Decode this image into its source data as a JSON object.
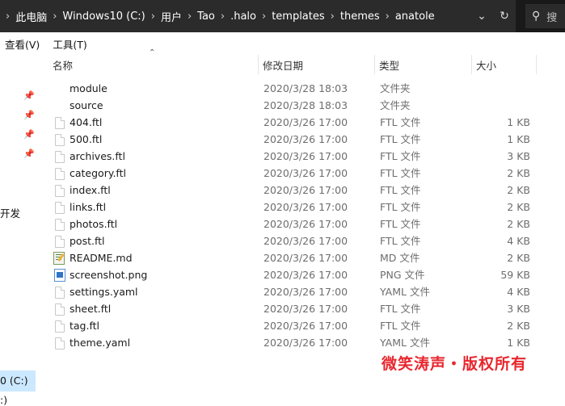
{
  "breadcrumb": [
    "此电脑",
    "Windows10 (C:)",
    "用户",
    "Tao",
    ".halo",
    "templates",
    "themes",
    "anatole"
  ],
  "search": {
    "placeholder": "搜"
  },
  "menu": [
    "查看(V)",
    "工具(T)"
  ],
  "sidebar": {
    "labels": [
      "开发",
      "0 (C:)",
      ":)"
    ]
  },
  "columns": {
    "name": "名称",
    "date": "修改日期",
    "type": "类型",
    "size": "大小"
  },
  "files": [
    {
      "name": "module",
      "date": "2020/3/28 18:03",
      "type": "文件夹",
      "size": "",
      "icon": "none"
    },
    {
      "name": "source",
      "date": "2020/3/28 18:03",
      "type": "文件夹",
      "size": "",
      "icon": "none"
    },
    {
      "name": "404.ftl",
      "date": "2020/3/26 17:00",
      "type": "FTL 文件",
      "size": "1 KB",
      "icon": "file"
    },
    {
      "name": "500.ftl",
      "date": "2020/3/26 17:00",
      "type": "FTL 文件",
      "size": "1 KB",
      "icon": "file"
    },
    {
      "name": "archives.ftl",
      "date": "2020/3/26 17:00",
      "type": "FTL 文件",
      "size": "3 KB",
      "icon": "file"
    },
    {
      "name": "category.ftl",
      "date": "2020/3/26 17:00",
      "type": "FTL 文件",
      "size": "2 KB",
      "icon": "file"
    },
    {
      "name": "index.ftl",
      "date": "2020/3/26 17:00",
      "type": "FTL 文件",
      "size": "2 KB",
      "icon": "file"
    },
    {
      "name": "links.ftl",
      "date": "2020/3/26 17:00",
      "type": "FTL 文件",
      "size": "2 KB",
      "icon": "file"
    },
    {
      "name": "photos.ftl",
      "date": "2020/3/26 17:00",
      "type": "FTL 文件",
      "size": "2 KB",
      "icon": "file"
    },
    {
      "name": "post.ftl",
      "date": "2020/3/26 17:00",
      "type": "FTL 文件",
      "size": "4 KB",
      "icon": "file"
    },
    {
      "name": "README.md",
      "date": "2020/3/26 17:00",
      "type": "MD 文件",
      "size": "2 KB",
      "icon": "markdown"
    },
    {
      "name": "screenshot.png",
      "date": "2020/3/26 17:00",
      "type": "PNG 文件",
      "size": "59 KB",
      "icon": "image"
    },
    {
      "name": "settings.yaml",
      "date": "2020/3/26 17:00",
      "type": "YAML 文件",
      "size": "4 KB",
      "icon": "file"
    },
    {
      "name": "sheet.ftl",
      "date": "2020/3/26 17:00",
      "type": "FTL 文件",
      "size": "3 KB",
      "icon": "file"
    },
    {
      "name": "tag.ftl",
      "date": "2020/3/26 17:00",
      "type": "FTL 文件",
      "size": "2 KB",
      "icon": "file"
    },
    {
      "name": "theme.yaml",
      "date": "2020/3/26 17:00",
      "type": "YAML 文件",
      "size": "1 KB",
      "icon": "file"
    }
  ],
  "watermark": "微笑涛声・版权所有",
  "colors": {
    "addressbar": "#2b2b2b",
    "selection": "#cce8ff",
    "watermark": "#e8262d"
  }
}
